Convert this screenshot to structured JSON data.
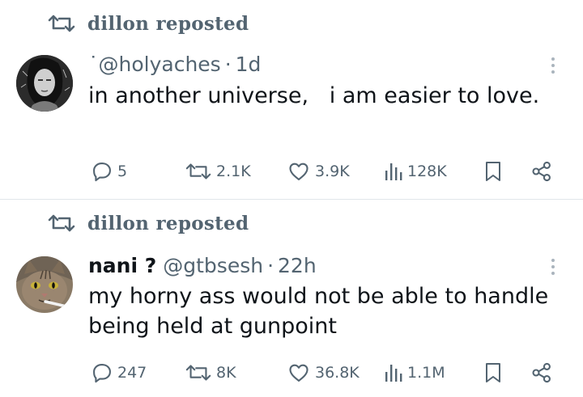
{
  "posts": [
    {
      "repost_label": "dillon reposted",
      "author_name": "",
      "handle": "˙@holyaches",
      "separator": "·",
      "time": "1d",
      "text": "in another universe,   i am easier to love.",
      "reply_count": "5",
      "repost_count": "2.1K",
      "like_count": "3.9K",
      "view_count": "128K"
    },
    {
      "repost_label": "dillon reposted",
      "author_name": "nani ?",
      "handle": "@gtbsesh",
      "separator": "·",
      "time": "22h",
      "text": "my horny ass would not be able to handle being held at gunpoint",
      "reply_count": "247",
      "repost_count": "8K",
      "like_count": "36.8K",
      "view_count": "1.1M"
    }
  ],
  "icons": {
    "repost": "repost-icon",
    "reply": "reply-icon",
    "like": "heart-icon",
    "views": "bar-chart-icon",
    "bookmark": "bookmark-icon",
    "share": "share-icon",
    "more": "more-vertical-icon"
  },
  "colors": {
    "secondary_text": "#536471",
    "primary_text": "#0f1419",
    "divider": "#e1e6ea"
  }
}
